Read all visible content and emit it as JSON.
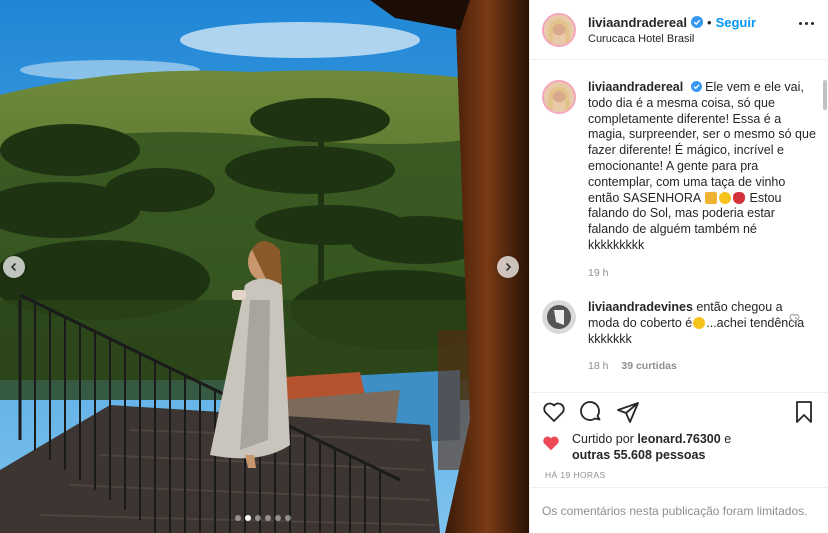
{
  "post": {
    "username": "liviaandradereal",
    "verified_icon": "verified-badge-icon",
    "separator": "•",
    "follow_label": "Seguir",
    "location": "Curucaca Hotel Brasil"
  },
  "caption": {
    "username": "liviaandradereal",
    "text_before_emoji": "Ele vem e ele vai, todo dia é a mesma coisa, só que completamente diferente! Essa é a magia, surpreender, ser o mesmo só que fazer diferente! É mágico, incrível e emocionante! A gente para pra contemplar, com uma taça de vinho então SASENHORA",
    "emojis": [
      "raising-hands-icon",
      "sun-icon",
      "rose-icon"
    ],
    "text_after_emoji": "Estou falando do Sol, mas poderia estar falando de alguém também né kkkkkkkkk",
    "time": "19 h"
  },
  "comment": {
    "username": "liviaandradevines",
    "text_before_emoji": "então chegou a moda do coberto é",
    "emoji": "thinking-face-icon",
    "text_after_emoji": "...achei tendência kkkkkkk",
    "time": "18 h",
    "likes": "39 curtidas"
  },
  "likes": {
    "prefix": "Curtido por",
    "user": "leonard.76300",
    "conj": "e",
    "others": "outras 55.608 pessoas"
  },
  "timestamp": "HÁ 19 HORAS",
  "comments_limited": "Os comentários nesta publicação foram limitados.",
  "carousel": {
    "slide_count": 6,
    "active_index": 1
  },
  "colors": {
    "accent": "#0095f6",
    "like_red": "#ed4956",
    "text": "#262626",
    "muted": "#8e8e8e"
  }
}
